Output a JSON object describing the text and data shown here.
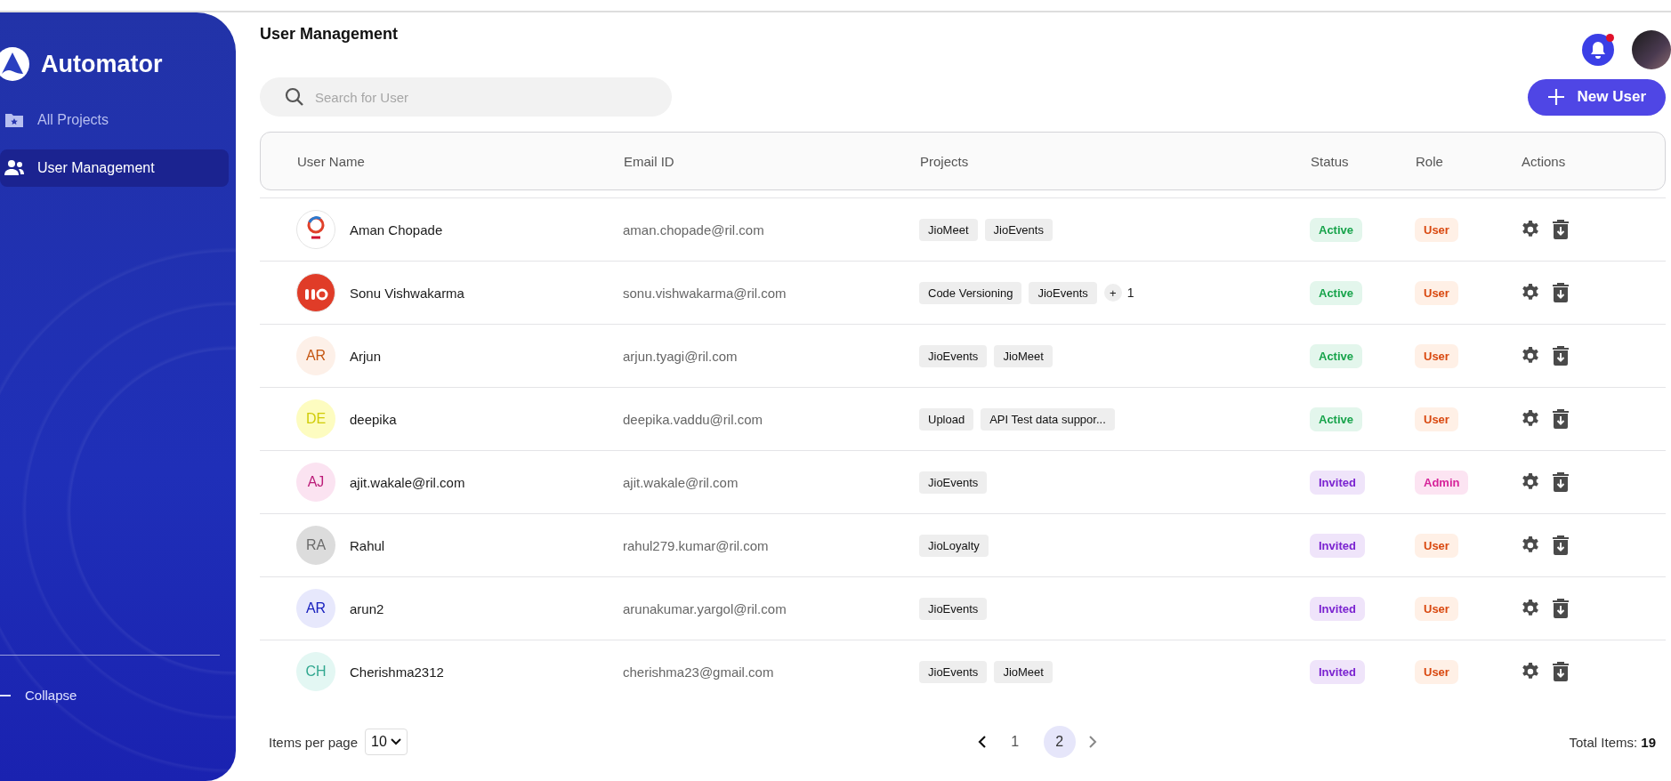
{
  "sidebar": {
    "brand": "Automator",
    "items": [
      {
        "label": "All Projects",
        "kind": "folder",
        "selected": false
      },
      {
        "label": "User Management",
        "kind": "users",
        "selected": true
      }
    ],
    "collapse": "Collapse"
  },
  "header": {
    "title": "User Management",
    "notifications_unread": true
  },
  "search": {
    "placeholder": "Search for User"
  },
  "new_user_button": {
    "label": "New User"
  },
  "table": {
    "columns": [
      "User Name",
      "Email ID",
      "Projects",
      "Status",
      "Role",
      "Actions"
    ],
    "rows": [
      {
        "avatar": {
          "kind": "ring"
        },
        "name": "Aman Chopade",
        "email": "aman.chopade@ril.com",
        "projects": [
          "JioMeet",
          "JioEvents"
        ],
        "status": {
          "label": "Active",
          "kind": "active"
        },
        "role": {
          "label": "User",
          "kind": "user"
        }
      },
      {
        "avatar": {
          "kind": "badge"
        },
        "name": "Sonu Vishwakarma",
        "email": "sonu.vishwakarma@ril.com",
        "projects": [
          "Code Versioning",
          "JioEvents"
        ],
        "more": {
          "sign": "+",
          "count": "1"
        },
        "status": {
          "label": "Active",
          "kind": "active"
        },
        "role": {
          "label": "User",
          "kind": "user"
        }
      },
      {
        "avatar": {
          "kind": "initials",
          "initials": "AR",
          "color": "#fdf0e8"
        },
        "name": "Arjun",
        "email": "arjun.tyagi@ril.com",
        "projects": [
          "JioEvents",
          "JioMeet"
        ],
        "status": {
          "label": "Active",
          "kind": "active"
        },
        "role": {
          "label": "User",
          "kind": "user"
        }
      },
      {
        "avatar": {
          "kind": "initials",
          "initials": "DE",
          "color": "#fdfcc0"
        },
        "name": "deepika",
        "email": "deepika.vaddu@ril.com",
        "projects": [
          "Upload",
          "API Test data suppor..."
        ],
        "status": {
          "label": "Active",
          "kind": "active"
        },
        "role": {
          "label": "User",
          "kind": "user"
        }
      },
      {
        "avatar": {
          "kind": "initials",
          "initials": "AJ",
          "color": "#fbe3f1"
        },
        "name": "ajit.wakale@ril.com",
        "email": "ajit.wakale@ril.com",
        "projects": [
          "JioEvents"
        ],
        "status": {
          "label": "Invited",
          "kind": "invited"
        },
        "role": {
          "label": "Admin",
          "kind": "admin"
        }
      },
      {
        "avatar": {
          "kind": "initials",
          "initials": "RA",
          "color": "#dcdcdc"
        },
        "name": "Rahul",
        "email": "rahul279.kumar@ril.com",
        "projects": [
          "JioLoyalty"
        ],
        "status": {
          "label": "Invited",
          "kind": "invited"
        },
        "role": {
          "label": "User",
          "kind": "user"
        }
      },
      {
        "avatar": {
          "kind": "initials",
          "initials": "AR",
          "color": "#e7e8fc"
        },
        "name": "arun2",
        "email": "arunakumar.yargol@ril.com",
        "projects": [
          "JioEvents"
        ],
        "status": {
          "label": "Invited",
          "kind": "invited"
        },
        "role": {
          "label": "User",
          "kind": "user"
        }
      },
      {
        "avatar": {
          "kind": "initials",
          "initials": "CH",
          "color": "#e3f7f3"
        },
        "name": "Cherishma2312",
        "email": "cherishma23@gmail.com",
        "projects": [
          "JioEvents",
          "JioMeet"
        ],
        "status": {
          "label": "Invited",
          "kind": "invited"
        },
        "role": {
          "label": "User",
          "kind": "user"
        }
      }
    ]
  },
  "footer": {
    "items_per_page_label": "Items per page",
    "items_per_page": "10",
    "pages": [
      {
        "label": "1",
        "selected": false
      },
      {
        "label": "2",
        "selected": true
      }
    ],
    "total": "Total Items: **19**"
  }
}
